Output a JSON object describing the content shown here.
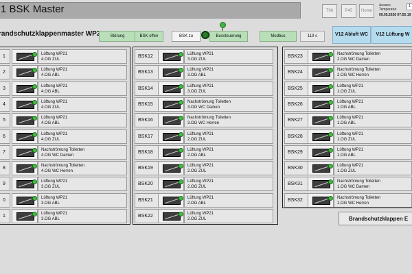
{
  "header": {
    "title": "1 BSK Master",
    "buttons": [
      "T06",
      "P45",
      "Home"
    ],
    "temp_label": "Aussen\nTemperatur",
    "temp_value": "1",
    "datetime": "09.05.2026 07:55:19"
  },
  "toolbar": {
    "section_title": "randschutzklappenmaster WP21:",
    "stoerung": "Störung",
    "bsk_offen": "BSK offen",
    "bsk_zu": "BSK zu",
    "bussteuerung": "Bussteuerung",
    "modbus": "Modbus",
    "seconds": "119 s",
    "v12_abluft": "V12 Abluft WC",
    "v12_lueftung": "V12 Lüftung W"
  },
  "colors": {
    "status_green": "#3cc43c",
    "button_green": "#b8dfb8",
    "button_blue": "#b5dcee"
  },
  "columns": [
    {
      "rows": [
        {
          "label": "1",
          "line1": "Lüftung WP21",
          "line2": "4.OG ZUL"
        },
        {
          "label": "2",
          "line1": "Lüftung WP21",
          "line2": "4.OG ABL"
        },
        {
          "label": "3",
          "line1": "Lüftung WP21",
          "line2": "4.OG ABL"
        },
        {
          "label": "4",
          "line1": "Lüftung WP21",
          "line2": "4.OG ZUL"
        },
        {
          "label": "5",
          "line1": "Lüftung WP21",
          "line2": "4.OG ABL"
        },
        {
          "label": "6",
          "line1": "Lüftung WP21",
          "line2": "4.OG ZUL"
        },
        {
          "label": "7",
          "line1": "Nachströmung Toiletten",
          "line2": "4.OG WC Damen"
        },
        {
          "label": "8",
          "line1": "Nachströmung Toiletten",
          "line2": "4.OG WC Herren"
        },
        {
          "label": "9",
          "line1": "Lüftung WP21",
          "line2": "3.OG ZUL"
        },
        {
          "label": "0",
          "line1": "Lüftung WP21",
          "line2": "3.OG ABL"
        },
        {
          "label": "1",
          "line1": "Lüftung WP21",
          "line2": "3.OG ABL"
        }
      ]
    },
    {
      "rows": [
        {
          "label": "BSK12",
          "line1": "Lüftung WP21",
          "line2": "3.OG ZUL"
        },
        {
          "label": "BSK13",
          "line1": "Lüftung WP21",
          "line2": "3.OG ABL"
        },
        {
          "label": "BSK14",
          "line1": "Lüftung WP21",
          "line2": "3.OG ZUL"
        },
        {
          "label": "BSK15",
          "line1": "Nachströmung Toiletten",
          "line2": "3.OG WC Damen"
        },
        {
          "label": "BSK16",
          "line1": "Nachströmung Toiletten",
          "line2": "3.OG WC Herren"
        },
        {
          "label": "BSK17",
          "line1": "Lüftung WP21",
          "line2": "2.OG ZUL"
        },
        {
          "label": "BSK18",
          "line1": "Lüftung WP21",
          "line2": "2.OG ABL"
        },
        {
          "label": "BSK19",
          "line1": "Lüftung WP21",
          "line2": "2.OG ZUL"
        },
        {
          "label": "BSK20",
          "line1": "Lüftung WP21",
          "line2": "2.OG ZUL"
        },
        {
          "label": "BSK21",
          "line1": "Lüftung WP21",
          "line2": "2.OG ABL"
        },
        {
          "label": "BSK22",
          "line1": "Lüftung WP21",
          "line2": "2.OG ZUL"
        }
      ]
    },
    {
      "rows": [
        {
          "label": "BSK23",
          "line1": "Nachströmung Toiletten",
          "line2": "2.OG WC Damen"
        },
        {
          "label": "BSK24",
          "line1": "Nachströmung Toiletten",
          "line2": "2.OG WC Herren"
        },
        {
          "label": "BSK25",
          "line1": "Lüftung WP21",
          "line2": "1.OG ZUL"
        },
        {
          "label": "BSK26",
          "line1": "Lüftung WP21",
          "line2": "1.OG ABL"
        },
        {
          "label": "BSK27",
          "line1": "Lüftung WP21",
          "line2": "1.OG ABL"
        },
        {
          "label": "BSK28",
          "line1": "Lüftung WP21",
          "line2": "1.OG ZUL"
        },
        {
          "label": "BSK29",
          "line1": "Lüftung WP21",
          "line2": "1.OG ABL"
        },
        {
          "label": "BSK30",
          "line1": "Lüftung WP21",
          "line2": "1.OG ZUL"
        },
        {
          "label": "BSK31",
          "line1": "Nachströmung Toiletten",
          "line2": "1.OG WC Damen"
        },
        {
          "label": "BSK32",
          "line1": "Nachströmung Toiletten",
          "line2": "1.OG WC Herren"
        }
      ]
    }
  ],
  "bottom_button": "Brandschutzklappen E"
}
